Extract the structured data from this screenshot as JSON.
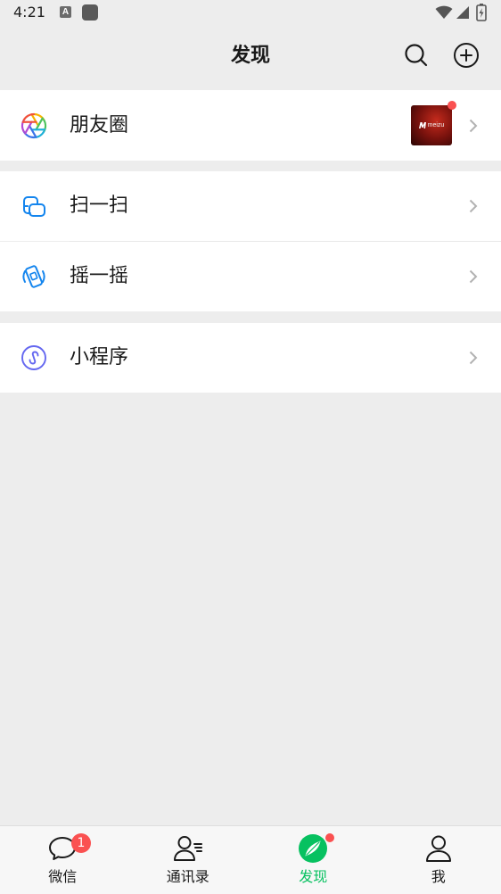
{
  "status_bar": {
    "time": "4:21",
    "notification_glyph": "A",
    "icons": [
      "font-notification-icon",
      "app-notification-icon",
      "wifi-icon",
      "signal-icon",
      "battery-charging-icon"
    ]
  },
  "header": {
    "title": "发现",
    "actions": [
      "search-icon",
      "plus-circle-icon"
    ]
  },
  "groups": [
    {
      "rows": [
        {
          "label": "朋友圈",
          "icon": "moments-aperture-icon",
          "thumbnail_logo": "meizu",
          "new_dot": true
        }
      ]
    },
    {
      "rows": [
        {
          "label": "扫一扫",
          "icon": "scan-icon"
        },
        {
          "label": "摇一摇",
          "icon": "shake-icon"
        }
      ]
    },
    {
      "rows": [
        {
          "label": "小程序",
          "icon": "mini-program-icon"
        }
      ]
    }
  ],
  "tabbar": {
    "tabs": [
      {
        "label": "微信",
        "icon": "chat-bubble-icon",
        "badge": "1",
        "active": false
      },
      {
        "label": "通讯录",
        "icon": "contacts-icon",
        "active": false
      },
      {
        "label": "发现",
        "icon": "discover-compass-icon",
        "active": true,
        "dot": true
      },
      {
        "label": "我",
        "icon": "me-person-icon",
        "active": false
      }
    ]
  },
  "colors": {
    "accent": "#07c160",
    "badge": "#fa5151",
    "background": "#ededed",
    "text": "#191919",
    "chevron": "#b2b2b2",
    "scan_blue": "#1485ee",
    "mini_program_purple": "#6467f0"
  }
}
